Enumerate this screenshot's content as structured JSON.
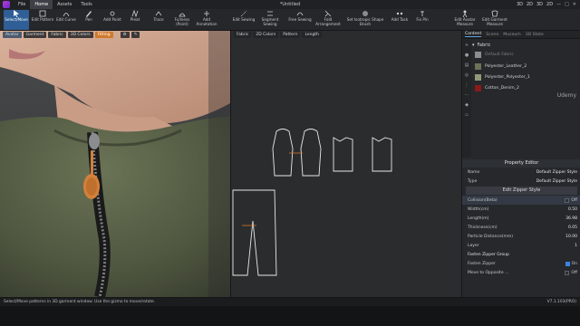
{
  "titlebar": {
    "menus": [
      "File",
      "Home",
      "Assets",
      "Tools"
    ],
    "active_menu": "Home",
    "doc_title": "*Untitled",
    "modes": [
      "3D",
      "2D",
      "3D",
      "2D"
    ]
  },
  "ribbon": {
    "tools": [
      {
        "label": "Select/Move",
        "icon": "cursor-icon",
        "active": true
      },
      {
        "label": "Edit Pattern",
        "icon": "edit-pattern-icon"
      },
      {
        "label": "Edit Curve",
        "icon": "curve-icon"
      },
      {
        "label": "Pen",
        "icon": "pen-icon"
      },
      {
        "label": "Add Point",
        "icon": "add-point-icon"
      },
      {
        "label": "Pleat",
        "icon": "pleat-icon"
      },
      {
        "label": "Trace",
        "icon": "trace-icon"
      },
      {
        "label": "Fullness\n(Point)",
        "icon": "fullness-icon"
      },
      {
        "label": "Add\nAnnotation",
        "icon": "annotation-icon"
      },
      {
        "label": "Edit Sewing",
        "icon": "edit-sewing-icon"
      },
      {
        "label": "Segment\nSewing",
        "icon": "segment-sewing-icon"
      },
      {
        "label": "Free Sewing",
        "icon": "free-sewing-icon"
      },
      {
        "label": "Fold\nArrangement",
        "icon": "fold-icon"
      },
      {
        "label": "Set Isotropic Shape Brush",
        "icon": "brush-icon"
      },
      {
        "label": "Add Tack",
        "icon": "tack-icon"
      },
      {
        "label": "Fix Pin",
        "icon": "pin-icon"
      },
      {
        "label": "Edit Avatar\nMeasure",
        "icon": "avatar-measure-icon"
      },
      {
        "label": "Edit Garment\nMeasure",
        "icon": "garment-measure-icon"
      }
    ]
  },
  "view3d": {
    "toolbar": [
      "Avatar",
      "Garment",
      "Fabric",
      "3D Colors",
      "Fitting"
    ]
  },
  "view2d": {
    "toolbar": [
      "Fabric",
      "2D Colors",
      "Pattern",
      "Length"
    ]
  },
  "side": {
    "tabs": [
      "Content",
      "Scene",
      "Museum",
      "3D State"
    ],
    "active_tab": "Content",
    "fabric_header": "Fabric",
    "fabrics": [
      {
        "name": "Default Fabric",
        "color": "#f2f2f2",
        "dim": true
      },
      {
        "name": "Polyester_Leather_2",
        "color": "#6b7356"
      },
      {
        "name": "Polyester_Polyester_1",
        "color": "#8e9a78"
      },
      {
        "name": "Cotton_Denim_2",
        "color": "#8a1a1a"
      }
    ]
  },
  "property_editor": {
    "title": "Property Editor",
    "name_label": "Name",
    "name_value": "Default Zipper Style",
    "type_label": "Type",
    "type_value": "Default Zipper Style",
    "edit_button": "Edit Zipper Style",
    "rows": [
      {
        "label": "Collision(Beta)",
        "value": "Off",
        "toggle": true,
        "on": false
      },
      {
        "label": "Width(cm)",
        "value": "0.50"
      },
      {
        "label": "Length(m)",
        "value": "36.98"
      },
      {
        "label": "Thickness(cm)",
        "value": "0.05"
      },
      {
        "label": "Particle Distance(mm)",
        "value": "10.00"
      },
      {
        "label": "Layer",
        "value": "1"
      }
    ],
    "group": "Fasten Zipper Group",
    "group_rows": [
      {
        "label": "Fasten Zipper",
        "value": "On",
        "on": true
      },
      {
        "label": "Move to Opposite ...",
        "value": "Off",
        "on": false
      }
    ]
  },
  "status": {
    "message": "Select/Move patterns in 3D garment window. Use the gizmo to move/rotate.",
    "version": "V7.1.103(PRO)"
  },
  "watermark": "Udemy",
  "colors": {
    "accent": "#2f5f96",
    "garment": "#5b6349",
    "zipper_pull": "#d4803a"
  }
}
